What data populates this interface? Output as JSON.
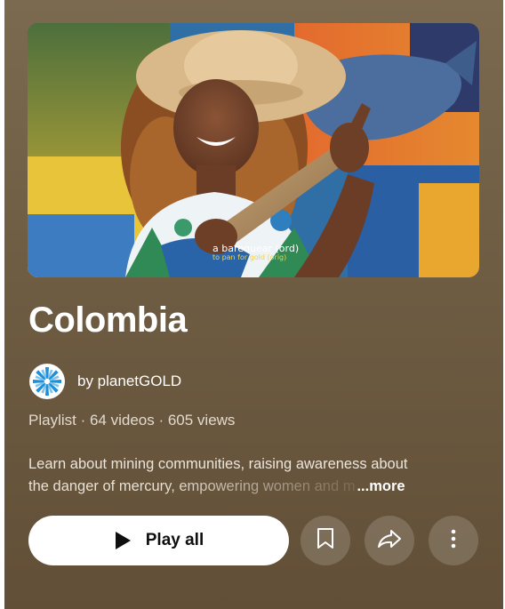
{
  "playlist": {
    "thumbnail": {
      "caption_line1": "a barequear (ord)",
      "caption_line2": "to pan for gold (orig)"
    },
    "title": "Colombia",
    "channel": {
      "byline": "by planetGOLD",
      "avatar_icon": "starburst-logo-icon"
    },
    "meta": "Playlist · 64 videos · 605 views",
    "description": {
      "line1": "Learn about mining communities, raising awareness about",
      "line2": "the danger of mercury, empowering women and m",
      "more_label": "...more"
    },
    "actions": {
      "play_all_label": "Play all",
      "play_icon": "play-icon",
      "save_icon": "bookmark-icon",
      "share_icon": "share-arrow-icon",
      "menu_icon": "more-vertical-icon"
    }
  },
  "colors": {
    "background": "#6f5d44",
    "button_white": "#ffffff",
    "accent_logo": "#1f8fd6"
  }
}
